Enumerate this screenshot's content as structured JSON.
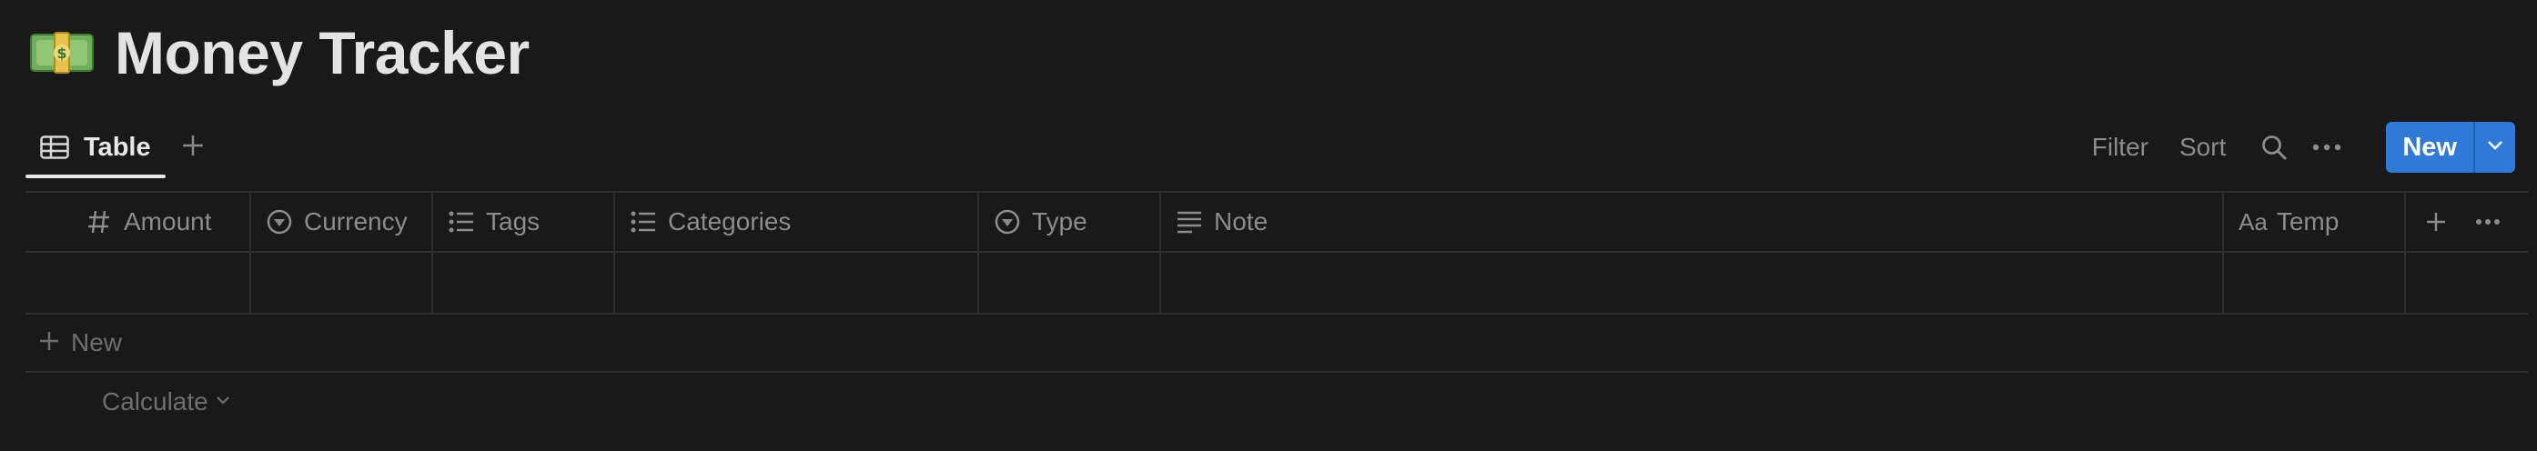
{
  "page": {
    "title": "Money Tracker",
    "icon": "money-bill-icon"
  },
  "views": {
    "tabs": [
      {
        "label": "Table",
        "icon": "table-icon",
        "active": true
      }
    ],
    "add_view_icon": "plus-icon"
  },
  "toolbar": {
    "filter_label": "Filter",
    "sort_label": "Sort",
    "search_icon": "search-icon",
    "more_icon": "more-icon",
    "new_label": "New",
    "new_caret_icon": "chevron-down-icon",
    "accent_color": "#2f7ad9"
  },
  "table": {
    "columns": [
      {
        "label": "Amount",
        "icon": "number-icon"
      },
      {
        "label": "Currency",
        "icon": "select-icon"
      },
      {
        "label": "Tags",
        "icon": "multi-select-icon"
      },
      {
        "label": "Categories",
        "icon": "multi-select-icon"
      },
      {
        "label": "Type",
        "icon": "select-icon"
      },
      {
        "label": "Note",
        "icon": "text-icon"
      },
      {
        "label": "Temp",
        "icon": "title-icon",
        "icon_text": "Aa"
      }
    ],
    "rows": [
      {
        "cells": [
          "",
          "",
          "",
          "",
          "",
          "",
          ""
        ]
      }
    ],
    "add_column_icon": "plus-icon",
    "column_options_icon": "more-icon",
    "new_row_label": "New",
    "calculate_label": "Calculate"
  }
}
